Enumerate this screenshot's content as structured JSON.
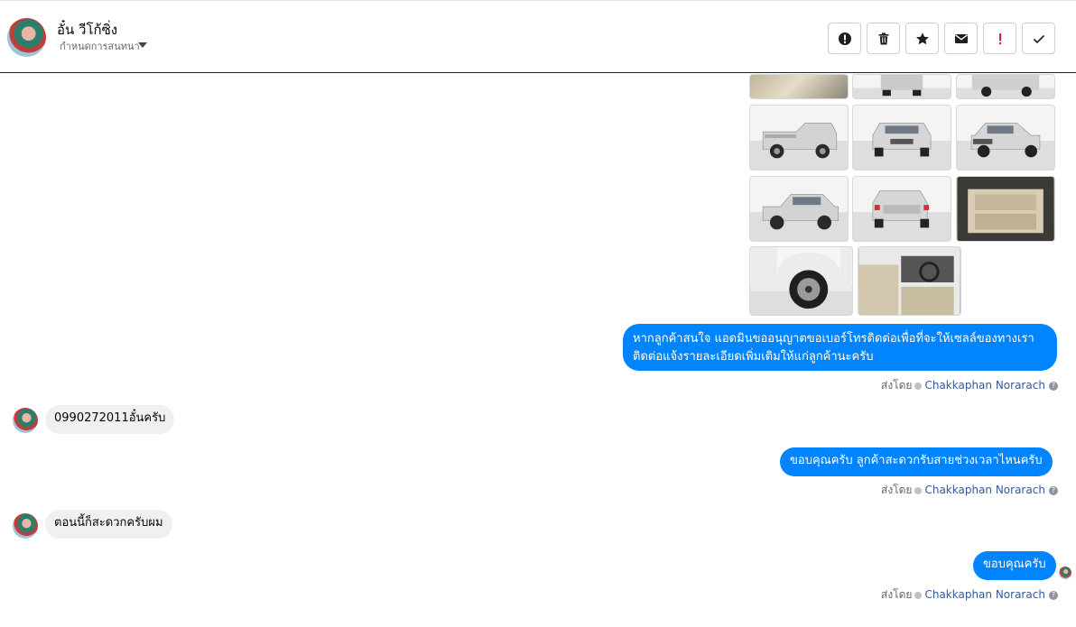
{
  "header": {
    "contact_name": "อั๋น วีโก้ซิ่ง",
    "subtitle": "กำหนดการสนทนา",
    "tools": [
      "report-icon",
      "trash-icon",
      "star-icon",
      "mail-icon",
      "important-icon",
      "check-icon"
    ]
  },
  "messages": [
    {
      "from": "page",
      "text_line1": "หากลูกค้าสนใจ แอดมินขออนุญาตขอเบอร์โทรติดต่อเพื่อที่จะให้เซลล์ของทางเรา",
      "text_line2": "ติดต่อแจ้งรายละเอียดเพิ่มเติมให้แก่ลูกค้านะครับ",
      "sent_label": "ส่งโดย",
      "sender": "Chakkaphan Norarach"
    },
    {
      "from": "customer",
      "text": "0990272011อั๋นครับ"
    },
    {
      "from": "page",
      "text": "ขอบคุณครับ ลูกค้าสะดวกรับสายช่วงเวลาไหนครับ",
      "sent_label": "ส่งโดย",
      "sender": "Chakkaphan Norarach"
    },
    {
      "from": "customer",
      "text": "ตอนนี้ก็สะดวกครับผม"
    },
    {
      "from": "page",
      "text": "ขอบคุณครับ",
      "sent_label": "ส่งโดย",
      "sender": "Chakkaphan Norarach"
    }
  ],
  "help_glyph": "?",
  "colors": {
    "accent": "#0084ff",
    "link": "#385898"
  }
}
